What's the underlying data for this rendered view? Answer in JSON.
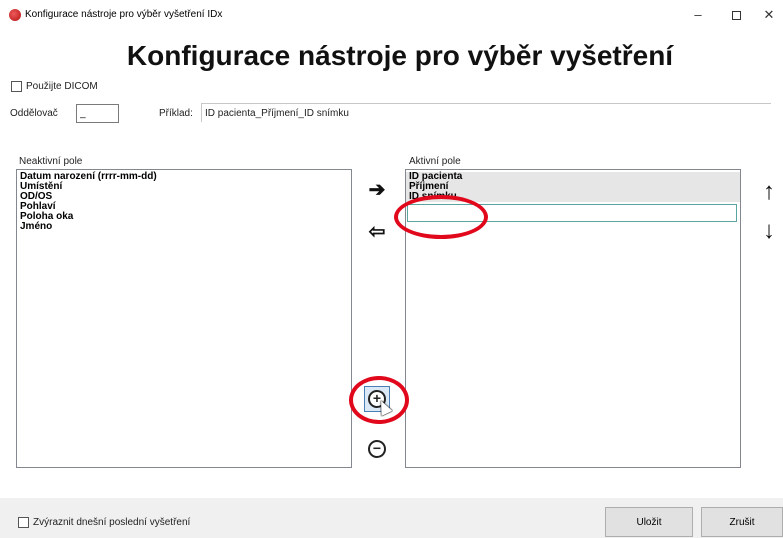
{
  "window": {
    "title": "Konfigurace nástroje pro výběr vyšetření IDx",
    "minimize": "–",
    "close": "✕"
  },
  "heading": "Konfigurace nástroje pro výběr vyšetření",
  "use_dicom": {
    "label": "Použijte DICOM",
    "checked": false
  },
  "separator": {
    "label": "Oddělovač",
    "value": "_"
  },
  "example": {
    "label": "Příklad:",
    "value": "ID pacienta_Příjmení_ID snímku"
  },
  "inactive_fields": {
    "label": "Neaktivní pole",
    "items": [
      "Datum narození (rrrr-mm-dd)",
      "Umístění",
      "OD/OS",
      "Pohlaví",
      "Poloha oka",
      "Jméno"
    ]
  },
  "active_fields": {
    "label": "Aktivní pole",
    "items": [
      "ID pacienta",
      "Příjmení",
      "ID snímku"
    ],
    "new_field_value": ""
  },
  "transfer_buttons": {
    "move_right": "➔",
    "move_left": "⇦"
  },
  "order_buttons": {
    "move_up": "↑",
    "move_down": "↓"
  },
  "field_buttons": {
    "add": "+",
    "remove": "−"
  },
  "highlight_today": {
    "label": "Zvýraznit dnešní poslední vyšetření",
    "checked": false
  },
  "buttons": {
    "save": "Uložit",
    "cancel": "Zrušit"
  },
  "colors": {
    "annotation_red": "#e1081c",
    "selected_row": "#e6e6e6",
    "edit_border": "#5aa5a0"
  }
}
